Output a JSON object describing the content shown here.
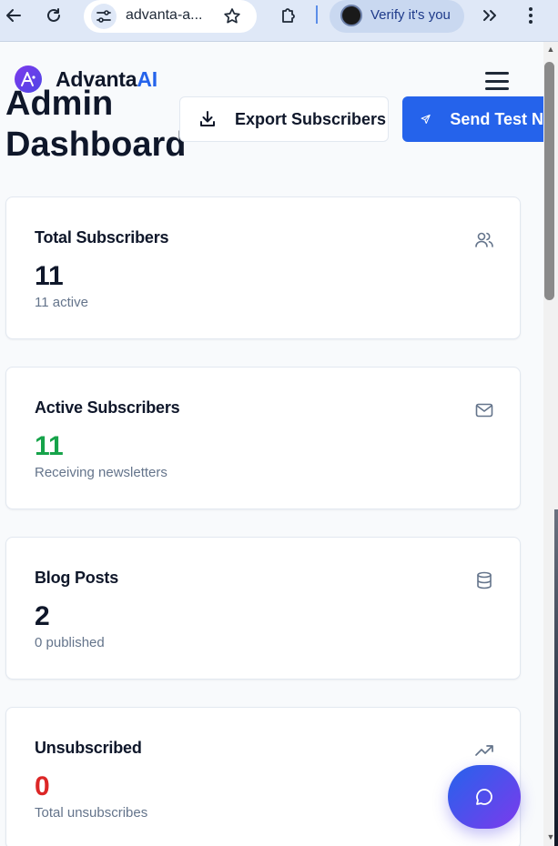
{
  "browser": {
    "url": "advanta-a...",
    "profile_label": "Verify it's you"
  },
  "brand": {
    "name_primary": "Advanta",
    "name_accent": "AI"
  },
  "page": {
    "title": "Admin Dashboard"
  },
  "actions": {
    "export_label": "Export Subscribers",
    "send_label": "Send Test N"
  },
  "stats": [
    {
      "title": "Total Subscribers",
      "value": "11",
      "sub": "11 active",
      "icon": "users-icon",
      "color": "#0f172a"
    },
    {
      "title": "Active Subscribers",
      "value": "11",
      "sub": "Receiving newsletters",
      "icon": "mail-icon",
      "color": "#16a34a"
    },
    {
      "title": "Blog Posts",
      "value": "2",
      "sub": "0 published",
      "icon": "database-icon",
      "color": "#0f172a"
    },
    {
      "title": "Unsubscribed",
      "value": "0",
      "sub": "Total unsubscribes",
      "icon": "trending-up-icon",
      "color": "#dc2626"
    }
  ],
  "colors": {
    "brand_accent": "#2563eb",
    "primary_button": "#2563eb",
    "active_value": "#16a34a",
    "unsubscribed_value": "#dc2626"
  }
}
